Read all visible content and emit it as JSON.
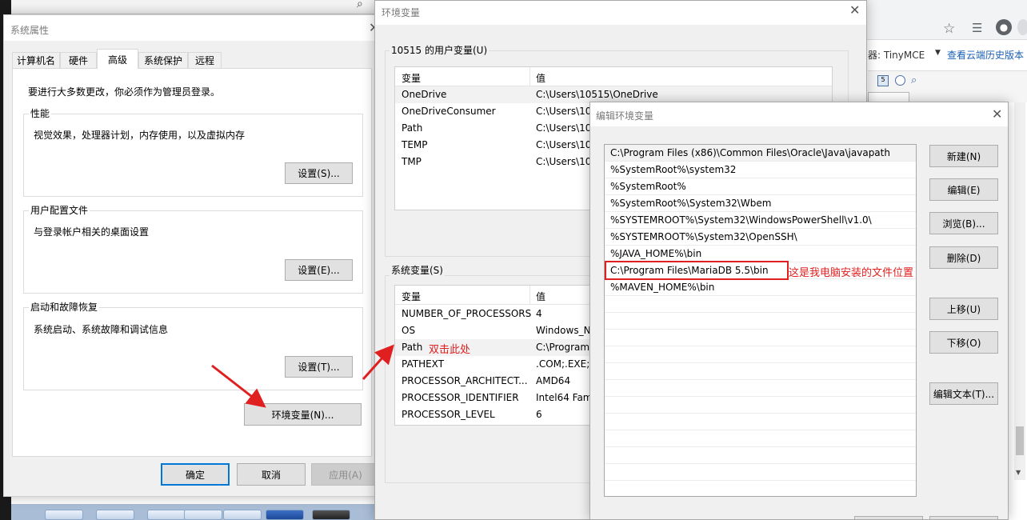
{
  "browser": {
    "editor_label": "器: TinyMCE",
    "history_link": "查看云端历史版本"
  },
  "sysprop": {
    "title": "系统属性",
    "tabs": [
      "计算机名",
      "硬件",
      "高级",
      "系统保护",
      "远程"
    ],
    "admin_note": "要进行大多数更改，你必须作为管理员登录。",
    "performance": {
      "label": "性能",
      "desc": "视觉效果，处理器计划，内存使用，以及虚拟内存",
      "button": "设置(S)..."
    },
    "profile": {
      "label": "用户配置文件",
      "desc": "与登录帐户相关的桌面设置",
      "button": "设置(E)..."
    },
    "startup": {
      "label": "启动和故障恢复",
      "desc": "系统启动、系统故障和调试信息",
      "button": "设置(T)..."
    },
    "env_button": "环境变量(N)...",
    "ok": "确定",
    "cancel": "取消",
    "apply": "应用(A)"
  },
  "envvars": {
    "title": "环境变量",
    "user_group": "10515 的用户变量(U)",
    "col_var": "变量",
    "col_val": "值",
    "user_vars": [
      {
        "name": "OneDrive",
        "value": "C:\\Users\\10515\\OneDrive"
      },
      {
        "name": "OneDriveConsumer",
        "value": "C:\\Users\\10"
      },
      {
        "name": "Path",
        "value": "C:\\Users\\10"
      },
      {
        "name": "TEMP",
        "value": "C:\\Users\\10"
      },
      {
        "name": "TMP",
        "value": "C:\\Users\\10"
      }
    ],
    "system_group": "系统变量(S)",
    "system_vars": [
      {
        "name": "NUMBER_OF_PROCESSORS",
        "value": "4"
      },
      {
        "name": "OS",
        "value": "Windows_N"
      },
      {
        "name": "Path",
        "value": "C:\\Program"
      },
      {
        "name": "PATHEXT",
        "value": ".COM;.EXE;."
      },
      {
        "name": "PROCESSOR_ARCHITECT...",
        "value": "AMD64"
      },
      {
        "name": "PROCESSOR_IDENTIFIER",
        "value": "Intel64 Fam"
      },
      {
        "name": "PROCESSOR_LEVEL",
        "value": "6"
      }
    ]
  },
  "annotations": {
    "double_click": "双击此处",
    "install_location": "这是我电脑安装的文件位置",
    "color": "#e02020"
  },
  "edit_env": {
    "title": "编辑环境变量",
    "paths": [
      "C:\\Program Files (x86)\\Common Files\\Oracle\\Java\\javapath",
      "%SystemRoot%\\system32",
      "%SystemRoot%",
      "%SystemRoot%\\System32\\Wbem",
      "%SYSTEMROOT%\\System32\\WindowsPowerShell\\v1.0\\",
      "%SYSTEMROOT%\\System32\\OpenSSH\\",
      "%JAVA_HOME%\\bin",
      "C:\\Program Files\\MariaDB 5.5\\bin",
      "%MAVEN_HOME%\\bin"
    ],
    "buttons": {
      "new": "新建(N)",
      "edit": "编辑(E)",
      "browse": "浏览(B)...",
      "delete": "删除(D)",
      "up": "上移(U)",
      "down": "下移(O)",
      "edit_text": "编辑文本(T)..."
    }
  }
}
